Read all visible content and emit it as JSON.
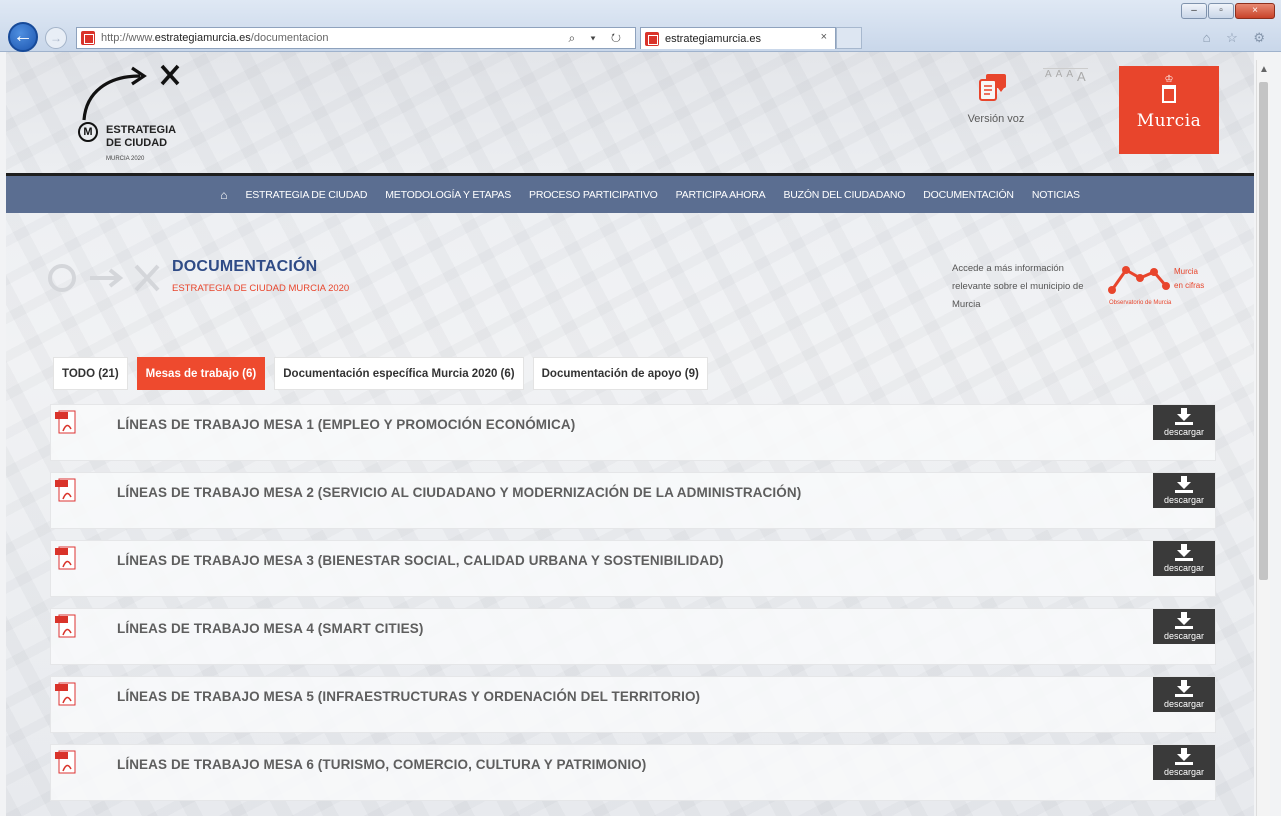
{
  "browser": {
    "url_prefix": "http://www.",
    "url_domain": "estrategiamurcia.es",
    "url_path": "/documentacion",
    "address_icons": "⌕ ▾ ↻",
    "tab_title": "estrategiamurcia.es",
    "tab_close": "×",
    "back_symbol": "←",
    "forward_symbol": "→",
    "window_buttons": [
      "–",
      "▫",
      "×"
    ],
    "toolbar_icons": "⌂ ☆ ⚙"
  },
  "header": {
    "logo_line1": "ESTRATEGIA",
    "logo_line2": "DE CIUDAD",
    "logo_sub": "MURCIA 2020",
    "logo_m": "M",
    "voice_label": "Versión voz",
    "font_sizes": [
      "A",
      "A",
      "A",
      "A"
    ],
    "murcia_label": "Murcia",
    "murcia_crown": "♔"
  },
  "nav": {
    "home_icon": "⌂",
    "items": [
      "ESTRATEGIA DE CIUDAD",
      "METODOLOGÍA Y ETAPAS",
      "PROCESO PARTICIPATIVO",
      "PARTICIPA AHORA",
      "BUZÓN DEL CIUDADANO",
      "DOCUMENTACIÓN",
      "NOTICIAS"
    ]
  },
  "section": {
    "title": "DOCUMENTACIÓN",
    "subtitle": "ESTRATEGIA DE CIUDAD MURCIA 2020",
    "obs_text": "Accede a más información relevante sobre el municipio de Murcia",
    "obs_logo_line1": "Murcia",
    "obs_logo_line2": "en cifras",
    "obs_logo_line3": "Observatorio de Murcia"
  },
  "tabs": [
    {
      "label": "TODO (21)",
      "active": false
    },
    {
      "label": "Mesas de trabajo (6)",
      "active": true
    },
    {
      "label": "Documentación específica Murcia 2020 (6)",
      "active": false
    },
    {
      "label": "Documentación de apoyo (9)",
      "active": false
    }
  ],
  "documents": [
    {
      "title": "LÍNEAS DE TRABAJO MESA 1 (EMPLEO Y PROMOCIÓN ECONÓMICA)",
      "button": "descargar"
    },
    {
      "title": "LÍNEAS DE TRABAJO MESA 2 (SERVICIO AL CIUDADANO Y MODERNIZACIÓN DE LA ADMINISTRACIÓN)",
      "button": "descargar"
    },
    {
      "title": "LÍNEAS DE TRABAJO MESA 3 (BIENESTAR SOCIAL, CALIDAD URBANA Y SOSTENIBILIDAD)",
      "button": "descargar"
    },
    {
      "title": "LÍNEAS DE TRABAJO MESA 4 (SMART CITIES)",
      "button": "descargar"
    },
    {
      "title": "LÍNEAS DE TRABAJO MESA 5 (INFRAESTRUCTURAS Y ORDENACIÓN DEL TERRITORIO)",
      "button": "descargar"
    },
    {
      "title": "LÍNEAS DE TRABAJO MESA 6 (TURISMO, COMERCIO, CULTURA Y PATRIMONIO)",
      "button": "descargar"
    }
  ],
  "colors": {
    "accent": "#ee4a2e",
    "nav_bg": "#5b6e91",
    "title_blue": "#2f4b86",
    "download_bg": "#3a3a3a"
  }
}
